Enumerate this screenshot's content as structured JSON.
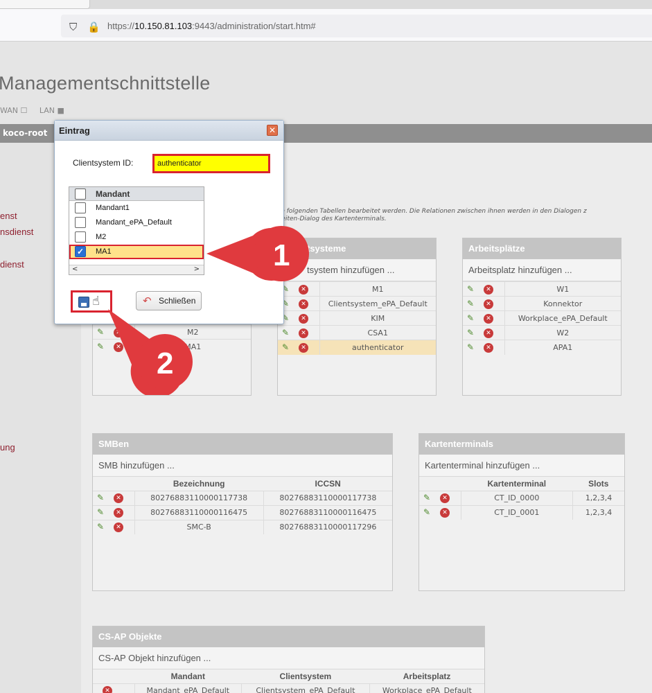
{
  "browser": {
    "url_prefix": "https://",
    "url_host": "10.150.81.103",
    "url_rest": ":9443/administration/start.htm#"
  },
  "header": {
    "title": "Managementschnittstelle",
    "wan_label": "WAN ☐",
    "lan_label": "LAN ■",
    "user": "koco-root"
  },
  "sidebar": {
    "items": [
      "enst",
      "nsdienst",
      "dienst",
      "ung"
    ]
  },
  "intro": {
    "line1": "die folgenden Tabellen bearbeitet werden. Die Relationen zwischen ihnen werden in den Dialogen z",
    "line2": "rbeiten-Dialog des Kartenterminals."
  },
  "dialog": {
    "title": "Eintrag",
    "clientsystem_label": "Clientsystem ID:",
    "clientsystem_value": "authenticator",
    "list_header": "Mandant",
    "mandanten": [
      "Mandant1",
      "Mandant_ePA_Default",
      "M2",
      "MA1"
    ],
    "close_label": "Schließen",
    "scroll_left": "<",
    "scroll_right": ">"
  },
  "mandant_panel_visible_rows": [
    "M2",
    "MA1"
  ],
  "clientsysteme": {
    "title": "tsysteme",
    "add": "tsystem hinzufügen ...",
    "rows": [
      "M1",
      "Clientsystem_ePA_Default",
      "KIM",
      "CSA1",
      "authenticator"
    ]
  },
  "arbeitsplaetze": {
    "title": "Arbeitsplätze",
    "add": "Arbeitsplatz hinzufügen ...",
    "rows": [
      "W1",
      "Konnektor",
      "Workplace_ePA_Default",
      "W2",
      "APA1"
    ]
  },
  "smben": {
    "title": "SMBen",
    "add": "SMB hinzufügen ...",
    "col1": "Bezeichnung",
    "col2": "ICCSN",
    "rows": [
      [
        "80276883110000117738",
        "80276883110000117738"
      ],
      [
        "80276883110000116475",
        "80276883110000116475"
      ],
      [
        "SMC-B",
        "80276883110000117296"
      ]
    ]
  },
  "kartenterminals": {
    "title": "Kartenterminals",
    "add": "Kartenterminal hinzufügen ...",
    "col1": "Kartenterminal",
    "col2": "Slots",
    "rows": [
      [
        "CT_ID_0000",
        "1,2,3,4"
      ],
      [
        "CT_ID_0001",
        "1,2,3,4"
      ]
    ]
  },
  "csap": {
    "title": "CS-AP Objekte",
    "add": "CS-AP Objekt hinzufügen ...",
    "col1": "Mandant",
    "col2": "Clientsystem",
    "col3": "Arbeitsplatz",
    "partial_row": [
      "Mandant_ePA_Default",
      "Clientsystem_ePA_Default",
      "Workplace_ePA_Default"
    ]
  },
  "callouts": [
    "1",
    "2"
  ],
  "colors": {
    "callout": "#e03a3e",
    "highlight_red": "#d9232f",
    "input_yellow": "#ffff00"
  }
}
